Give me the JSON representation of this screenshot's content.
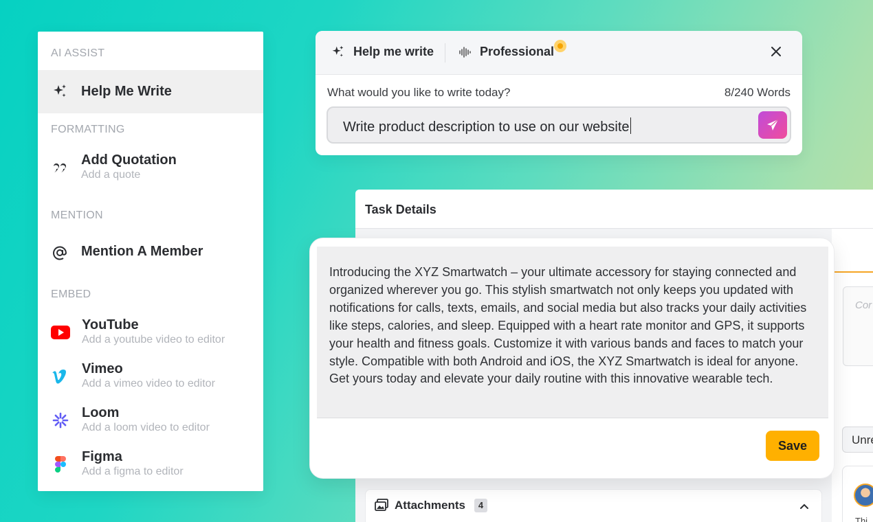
{
  "menu": {
    "sections": {
      "ai_assist": "AI ASSIST",
      "formatting": "FORMATTING",
      "mention": "MENTION",
      "embed": "EMBED"
    },
    "items": {
      "help_me_write": {
        "title": "Help Me Write",
        "icon": "sparkles-icon"
      },
      "add_quotation": {
        "title": "Add Quotation",
        "subtitle": "Add a quote",
        "icon": "quote-icon"
      },
      "mention_member": {
        "title": "Mention A Member",
        "icon": "at-icon"
      },
      "youtube": {
        "title": "YouTube",
        "subtitle": "Add a youtube video to editor",
        "icon": "youtube-icon"
      },
      "vimeo": {
        "title": "Vimeo",
        "subtitle": "Add a vimeo video to editor",
        "icon": "vimeo-icon"
      },
      "loom": {
        "title": "Loom",
        "subtitle": "Add a loom video to editor",
        "icon": "loom-icon"
      },
      "figma": {
        "title": "Figma",
        "subtitle": "Add a figma to editor",
        "icon": "figma-icon"
      }
    }
  },
  "ai_box": {
    "mode_label": "Help me write",
    "tone_label": "Professional",
    "prompt_label": "What would you like to write today?",
    "word_count": "8/240 Words",
    "input_value": "Write product description to use on our website"
  },
  "task": {
    "title": "Task Details",
    "comment_placeholder": "Cor",
    "status_select": "Unre",
    "avatar_caption": "Thi",
    "attachments_label": "Attachments",
    "attachments_count": "4"
  },
  "result": {
    "text": "Introducing the XYZ Smartwatch – your ultimate accessory for staying connected and organized wherever you go. This stylish smartwatch not only keeps you updated with notifications for calls, texts, emails, and social media but also tracks your daily activities like steps, calories, and sleep. Equipped with a heart rate monitor and GPS, it supports your health and fitness goals. Customize it with various bands and faces to match your style. Compatible with both Android and iOS, the XYZ Smartwatch is ideal for anyone. Get yours today and elevate your daily routine with this innovative wearable tech.",
    "save_label": "Save"
  },
  "colors": {
    "accent_save": "#ffb000",
    "send_gradient_start": "#c04bd9",
    "send_gradient_end": "#f04d9c",
    "youtube_red": "#ff0000",
    "vimeo_blue": "#1ab7ea",
    "loom_purple": "#625df5"
  }
}
